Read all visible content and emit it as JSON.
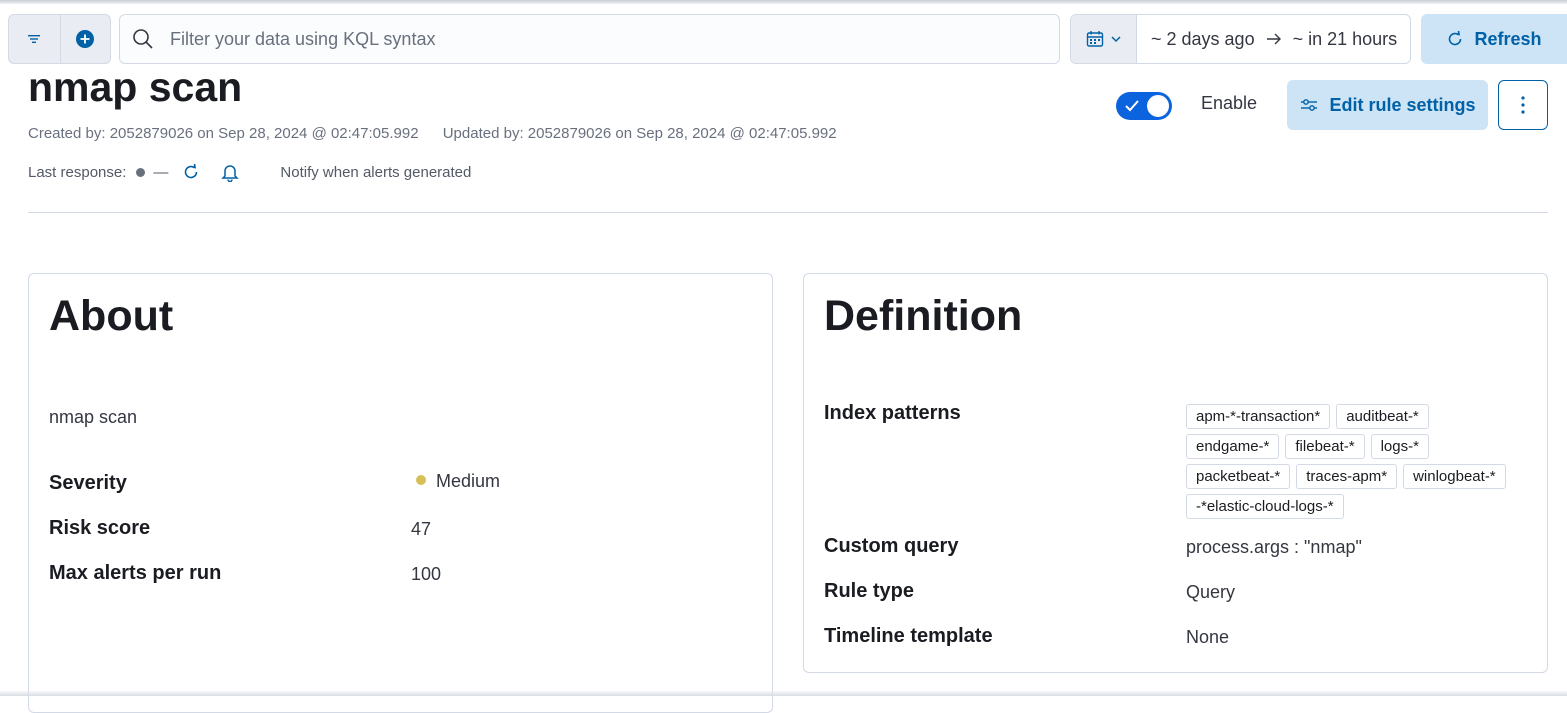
{
  "querybar": {
    "kql_placeholder": "Filter your data using KQL syntax",
    "date_start": "~ 2 days ago",
    "date_end": "~ in 21 hours",
    "refresh_label": "Refresh"
  },
  "rule": {
    "title": "nmap scan",
    "created": "Created by: 2052879026 on Sep 28, 2024 @ 02:47:05.992",
    "updated": "Updated by: 2052879026 on Sep 28, 2024 @ 02:47:05.992",
    "last_response_label": "Last response:",
    "last_response_value": "—",
    "notify_label": "Notify when alerts generated",
    "enable_label": "Enable",
    "enabled": true,
    "edit_settings_label": "Edit rule settings"
  },
  "about": {
    "heading": "About",
    "description": "nmap scan",
    "severity_label": "Severity",
    "severity_value": "Medium",
    "severity_color": "#d6bf57",
    "risk_label": "Risk score",
    "risk_value": "47",
    "max_alerts_label": "Max alerts per run",
    "max_alerts_value": "100"
  },
  "definition": {
    "heading": "Definition",
    "index_label": "Index patterns",
    "index_patterns": [
      "apm-*-transaction*",
      "auditbeat-*",
      "endgame-*",
      "filebeat-*",
      "logs-*",
      "packetbeat-*",
      "traces-apm*",
      "winlogbeat-*",
      "-*elastic-cloud-logs-*"
    ],
    "query_label": "Custom query",
    "query_value": "process.args : \"nmap\"",
    "type_label": "Rule type",
    "type_value": "Query",
    "timeline_label": "Timeline template",
    "timeline_value": "None"
  },
  "colors": {
    "primary": "#0061a6",
    "primary_light": "#cce4f5",
    "toggle_on": "#0b64dd"
  }
}
